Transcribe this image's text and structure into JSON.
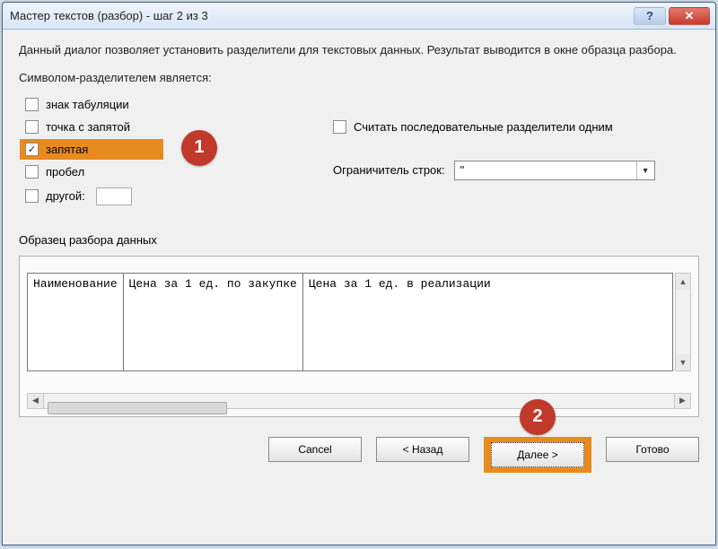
{
  "window": {
    "title": "Мастер текстов (разбор) - шаг 2 из 3"
  },
  "description": "Данный диалог позволяет установить разделители для текстовых данных. Результат выводится в окне образца разбора.",
  "delimGroupLabel": "Символом-разделителем является:",
  "delimiters": {
    "tab": "знак табуляции",
    "semicolon": "точка с запятой",
    "comma": "запятая",
    "space": "пробел",
    "other": "другой:"
  },
  "checked": {
    "tab": false,
    "semicolon": false,
    "comma": true,
    "space": false,
    "other": false
  },
  "consecutive": {
    "label": "Считать последовательные разделители одним",
    "checked": false
  },
  "textQualifier": {
    "label": "Ограничитель строк:",
    "value": "\""
  },
  "previewLabel": "Образец разбора данных",
  "previewColumns": [
    "Наименование",
    "Цена за 1 ед. по закупке",
    "Цена за 1 ед. в реализации"
  ],
  "buttons": {
    "cancel": "Cancel",
    "back": "< Назад",
    "next": "Далее >",
    "finish": "Готово"
  },
  "annotations": {
    "badge1": "1",
    "badge2": "2"
  }
}
